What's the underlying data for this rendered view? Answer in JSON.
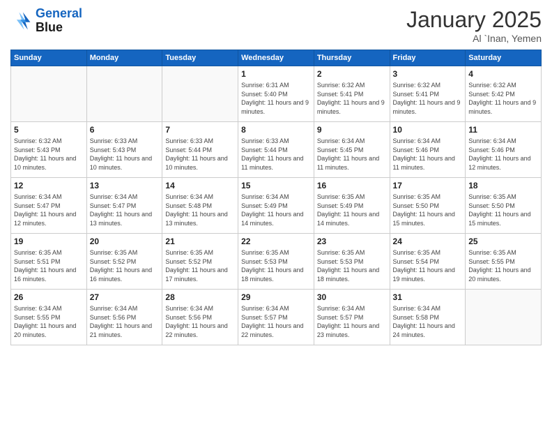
{
  "header": {
    "logo_line1": "General",
    "logo_line2": "Blue",
    "month": "January 2025",
    "location": "Al `Inan, Yemen"
  },
  "weekdays": [
    "Sunday",
    "Monday",
    "Tuesday",
    "Wednesday",
    "Thursday",
    "Friday",
    "Saturday"
  ],
  "weeks": [
    [
      {
        "day": "",
        "sunrise": "",
        "sunset": "",
        "daylight": ""
      },
      {
        "day": "",
        "sunrise": "",
        "sunset": "",
        "daylight": ""
      },
      {
        "day": "",
        "sunrise": "",
        "sunset": "",
        "daylight": ""
      },
      {
        "day": "1",
        "sunrise": "Sunrise: 6:31 AM",
        "sunset": "Sunset: 5:40 PM",
        "daylight": "Daylight: 11 hours and 9 minutes."
      },
      {
        "day": "2",
        "sunrise": "Sunrise: 6:32 AM",
        "sunset": "Sunset: 5:41 PM",
        "daylight": "Daylight: 11 hours and 9 minutes."
      },
      {
        "day": "3",
        "sunrise": "Sunrise: 6:32 AM",
        "sunset": "Sunset: 5:41 PM",
        "daylight": "Daylight: 11 hours and 9 minutes."
      },
      {
        "day": "4",
        "sunrise": "Sunrise: 6:32 AM",
        "sunset": "Sunset: 5:42 PM",
        "daylight": "Daylight: 11 hours and 9 minutes."
      }
    ],
    [
      {
        "day": "5",
        "sunrise": "Sunrise: 6:32 AM",
        "sunset": "Sunset: 5:43 PM",
        "daylight": "Daylight: 11 hours and 10 minutes."
      },
      {
        "day": "6",
        "sunrise": "Sunrise: 6:33 AM",
        "sunset": "Sunset: 5:43 PM",
        "daylight": "Daylight: 11 hours and 10 minutes."
      },
      {
        "day": "7",
        "sunrise": "Sunrise: 6:33 AM",
        "sunset": "Sunset: 5:44 PM",
        "daylight": "Daylight: 11 hours and 10 minutes."
      },
      {
        "day": "8",
        "sunrise": "Sunrise: 6:33 AM",
        "sunset": "Sunset: 5:44 PM",
        "daylight": "Daylight: 11 hours and 11 minutes."
      },
      {
        "day": "9",
        "sunrise": "Sunrise: 6:34 AM",
        "sunset": "Sunset: 5:45 PM",
        "daylight": "Daylight: 11 hours and 11 minutes."
      },
      {
        "day": "10",
        "sunrise": "Sunrise: 6:34 AM",
        "sunset": "Sunset: 5:46 PM",
        "daylight": "Daylight: 11 hours and 11 minutes."
      },
      {
        "day": "11",
        "sunrise": "Sunrise: 6:34 AM",
        "sunset": "Sunset: 5:46 PM",
        "daylight": "Daylight: 11 hours and 12 minutes."
      }
    ],
    [
      {
        "day": "12",
        "sunrise": "Sunrise: 6:34 AM",
        "sunset": "Sunset: 5:47 PM",
        "daylight": "Daylight: 11 hours and 12 minutes."
      },
      {
        "day": "13",
        "sunrise": "Sunrise: 6:34 AM",
        "sunset": "Sunset: 5:47 PM",
        "daylight": "Daylight: 11 hours and 13 minutes."
      },
      {
        "day": "14",
        "sunrise": "Sunrise: 6:34 AM",
        "sunset": "Sunset: 5:48 PM",
        "daylight": "Daylight: 11 hours and 13 minutes."
      },
      {
        "day": "15",
        "sunrise": "Sunrise: 6:34 AM",
        "sunset": "Sunset: 5:49 PM",
        "daylight": "Daylight: 11 hours and 14 minutes."
      },
      {
        "day": "16",
        "sunrise": "Sunrise: 6:35 AM",
        "sunset": "Sunset: 5:49 PM",
        "daylight": "Daylight: 11 hours and 14 minutes."
      },
      {
        "day": "17",
        "sunrise": "Sunrise: 6:35 AM",
        "sunset": "Sunset: 5:50 PM",
        "daylight": "Daylight: 11 hours and 15 minutes."
      },
      {
        "day": "18",
        "sunrise": "Sunrise: 6:35 AM",
        "sunset": "Sunset: 5:50 PM",
        "daylight": "Daylight: 11 hours and 15 minutes."
      }
    ],
    [
      {
        "day": "19",
        "sunrise": "Sunrise: 6:35 AM",
        "sunset": "Sunset: 5:51 PM",
        "daylight": "Daylight: 11 hours and 16 minutes."
      },
      {
        "day": "20",
        "sunrise": "Sunrise: 6:35 AM",
        "sunset": "Sunset: 5:52 PM",
        "daylight": "Daylight: 11 hours and 16 minutes."
      },
      {
        "day": "21",
        "sunrise": "Sunrise: 6:35 AM",
        "sunset": "Sunset: 5:52 PM",
        "daylight": "Daylight: 11 hours and 17 minutes."
      },
      {
        "day": "22",
        "sunrise": "Sunrise: 6:35 AM",
        "sunset": "Sunset: 5:53 PM",
        "daylight": "Daylight: 11 hours and 18 minutes."
      },
      {
        "day": "23",
        "sunrise": "Sunrise: 6:35 AM",
        "sunset": "Sunset: 5:53 PM",
        "daylight": "Daylight: 11 hours and 18 minutes."
      },
      {
        "day": "24",
        "sunrise": "Sunrise: 6:35 AM",
        "sunset": "Sunset: 5:54 PM",
        "daylight": "Daylight: 11 hours and 19 minutes."
      },
      {
        "day": "25",
        "sunrise": "Sunrise: 6:35 AM",
        "sunset": "Sunset: 5:55 PM",
        "daylight": "Daylight: 11 hours and 20 minutes."
      }
    ],
    [
      {
        "day": "26",
        "sunrise": "Sunrise: 6:34 AM",
        "sunset": "Sunset: 5:55 PM",
        "daylight": "Daylight: 11 hours and 20 minutes."
      },
      {
        "day": "27",
        "sunrise": "Sunrise: 6:34 AM",
        "sunset": "Sunset: 5:56 PM",
        "daylight": "Daylight: 11 hours and 21 minutes."
      },
      {
        "day": "28",
        "sunrise": "Sunrise: 6:34 AM",
        "sunset": "Sunset: 5:56 PM",
        "daylight": "Daylight: 11 hours and 22 minutes."
      },
      {
        "day": "29",
        "sunrise": "Sunrise: 6:34 AM",
        "sunset": "Sunset: 5:57 PM",
        "daylight": "Daylight: 11 hours and 22 minutes."
      },
      {
        "day": "30",
        "sunrise": "Sunrise: 6:34 AM",
        "sunset": "Sunset: 5:57 PM",
        "daylight": "Daylight: 11 hours and 23 minutes."
      },
      {
        "day": "31",
        "sunrise": "Sunrise: 6:34 AM",
        "sunset": "Sunset: 5:58 PM",
        "daylight": "Daylight: 11 hours and 24 minutes."
      },
      {
        "day": "",
        "sunrise": "",
        "sunset": "",
        "daylight": ""
      }
    ]
  ]
}
